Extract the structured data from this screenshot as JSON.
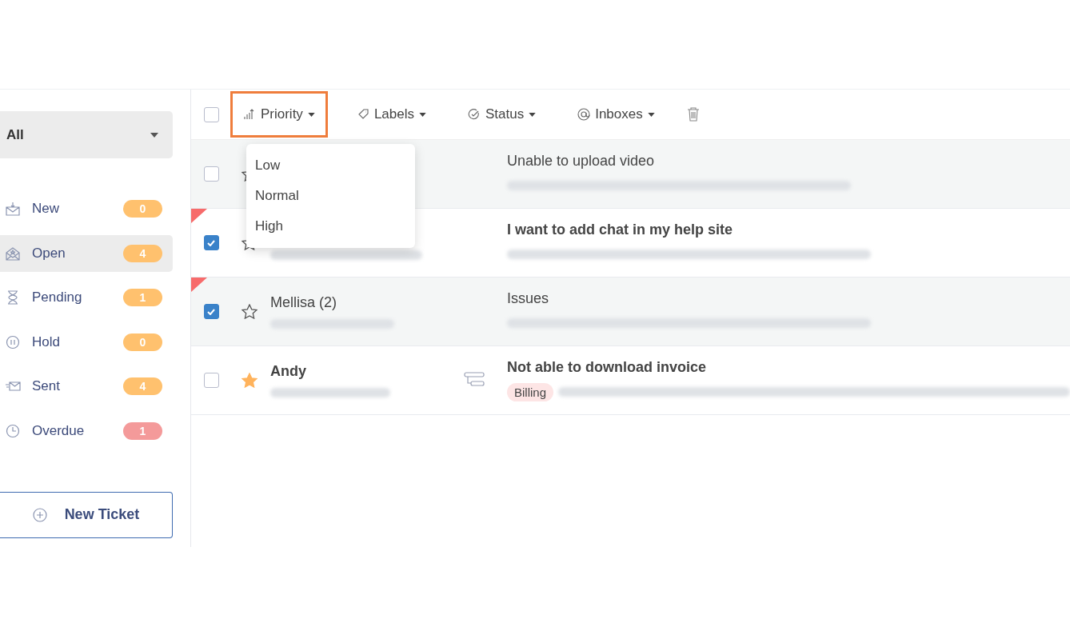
{
  "sidebar": {
    "filter": {
      "value": "All"
    },
    "items": [
      {
        "label": "New",
        "count": "0",
        "selected": false,
        "color": "#ffc16e"
      },
      {
        "label": "Open",
        "count": "4",
        "selected": true,
        "color": "#ffc16e"
      },
      {
        "label": "Pending",
        "count": "1",
        "selected": false,
        "color": "#ffc16e"
      },
      {
        "label": "Hold",
        "count": "0",
        "selected": false,
        "color": "#ffc16e"
      },
      {
        "label": "Sent",
        "count": "4",
        "selected": false,
        "color": "#ffc16e"
      },
      {
        "label": "Overdue",
        "count": "1",
        "selected": false,
        "color": "#f49a9a"
      }
    ],
    "new_ticket": "New Ticket"
  },
  "toolbar": {
    "select_all": {
      "checked": false
    },
    "actions": [
      {
        "label": "Priority",
        "highlighted": true
      },
      {
        "label": "Labels",
        "highlighted": false
      },
      {
        "label": "Status",
        "highlighted": false
      },
      {
        "label": "Inboxes",
        "highlighted": false
      }
    ]
  },
  "priority_menu": [
    "Low",
    "Normal",
    "High"
  ],
  "tickets": [
    {
      "checked": false,
      "starred": false,
      "unread": false,
      "urgent": false,
      "subject": "Unable to upload video"
    },
    {
      "checked": true,
      "starred": false,
      "unread": true,
      "urgent": true,
      "subject": "I want to add chat in my help site"
    },
    {
      "checked": true,
      "starred": false,
      "unread": false,
      "urgent": true,
      "name": "Mellisa (2)",
      "subject": "Issues"
    },
    {
      "checked": false,
      "starred": true,
      "unread": true,
      "urgent": false,
      "name": "Andy",
      "subject": "Not able to download invoice",
      "merged": true,
      "tags": [
        "Billing"
      ]
    }
  ]
}
